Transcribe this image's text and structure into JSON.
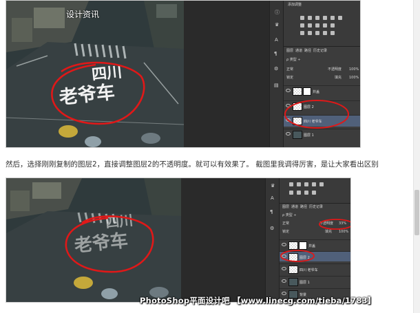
{
  "top_tag": "设计资讯",
  "caption": "然后，选择刚刚复制的图层2，直接调整图层2的不透明度。就可以有效果了。 截图里我调得厉害，是让大家看出区别",
  "watermark": "PhotoShop平面设计吧 【www.linecg.com/tieba/1783】",
  "road_text": {
    "line1": "四川",
    "line2": "老爷车"
  },
  "screenshot1": {
    "panel_title": "添加调整",
    "tabs": [
      "图层",
      "通道",
      "路径",
      "历史记录"
    ],
    "blend_mode": "正常",
    "opacity_label": "不透明度",
    "opacity_value": "100%",
    "lock_label": "锁定",
    "fill_label": "填充",
    "fill_value": "100%",
    "layers": [
      {
        "name": "井盖",
        "type": "mask",
        "selected": false
      },
      {
        "name": "图层 2",
        "type": "normal",
        "selected": false
      },
      {
        "name": "四川 老爷车",
        "type": "text",
        "selected": true
      },
      {
        "name": "图层 1",
        "type": "image",
        "selected": false
      }
    ]
  },
  "screenshot2": {
    "tabs": [
      "图层",
      "通道",
      "路径",
      "历史记录"
    ],
    "blend_mode": "正常",
    "opacity_label": "不透明度",
    "opacity_value": "33%",
    "lock_label": "锁定",
    "fill_label": "填充",
    "fill_value": "100%",
    "layers": [
      {
        "name": "井盖",
        "type": "mask",
        "selected": false
      },
      {
        "name": "图层 2",
        "type": "normal",
        "selected": true
      },
      {
        "name": "四川 老爷车",
        "type": "text",
        "selected": false
      },
      {
        "name": "图层 1",
        "type": "image",
        "selected": false
      },
      {
        "name": "背景",
        "type": "image",
        "selected": false
      }
    ]
  },
  "colors": {
    "annotation": "#e01818",
    "ps_panel": "#3c3c3c",
    "selected_layer": "#50607a"
  }
}
